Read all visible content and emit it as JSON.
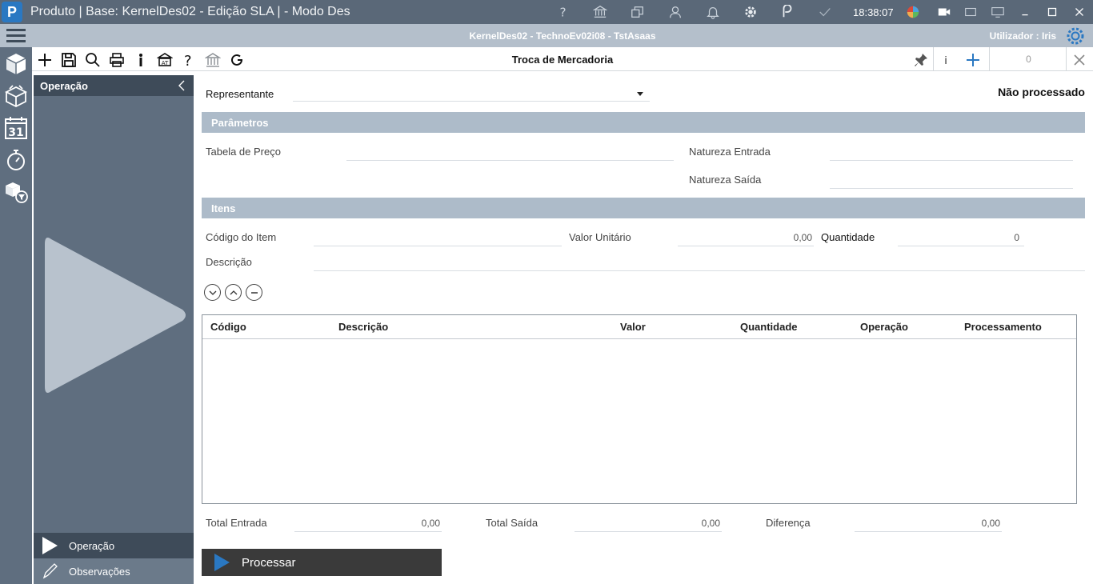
{
  "window": {
    "title": "Produto | Base: KernelDes02 - Edição SLA | - Modo Des",
    "clock": "18:38:07",
    "logo_letter": "P"
  },
  "infobar": {
    "context": "KernelDes02 - TechnoEv02i08 - TstAsaas",
    "user": "Utilizador : Iris"
  },
  "toolbar": {
    "form_title": "Troca de Mercadoria",
    "info_label": "i",
    "counter": "0"
  },
  "sidepanel": {
    "header": "Operação",
    "nav": [
      {
        "label": "Operação"
      },
      {
        "label": "Observações"
      }
    ]
  },
  "form": {
    "representante_label": "Representante",
    "representante_value": "",
    "status": "Não processado",
    "sections": {
      "parametros": "Parâmetros",
      "itens": "Itens"
    },
    "tabela_preco_label": "Tabela de Preço",
    "natureza_entrada_label": "Natureza Entrada",
    "natureza_saida_label": "Natureza Saída",
    "codigo_item_label": "Código do Item",
    "valor_unitario_label": "Valor Unitário",
    "valor_unitario_value": "0,00",
    "quantidade_label": "Quantidade",
    "quantidade_value": "0",
    "descricao_label": "Descrição"
  },
  "grid": {
    "columns": [
      "Código",
      "Descrição",
      "Valor",
      "Quantidade",
      "Operação",
      "Processamento"
    ],
    "rows": []
  },
  "totals": {
    "entrada_label": "Total Entrada",
    "entrada_value": "0,00",
    "saida_label": "Total Saída",
    "saida_value": "0,00",
    "diferenca_label": "Diferença",
    "diferenca_value": "0,00"
  },
  "process_button": "Processar",
  "colors": {
    "titlebar": "#5a6878",
    "infobar": "#b4bfcb",
    "rail": "#5f6e7f",
    "section": "#adbbc9",
    "accent": "#2a78c2",
    "process_button": "#3a3a3a"
  }
}
